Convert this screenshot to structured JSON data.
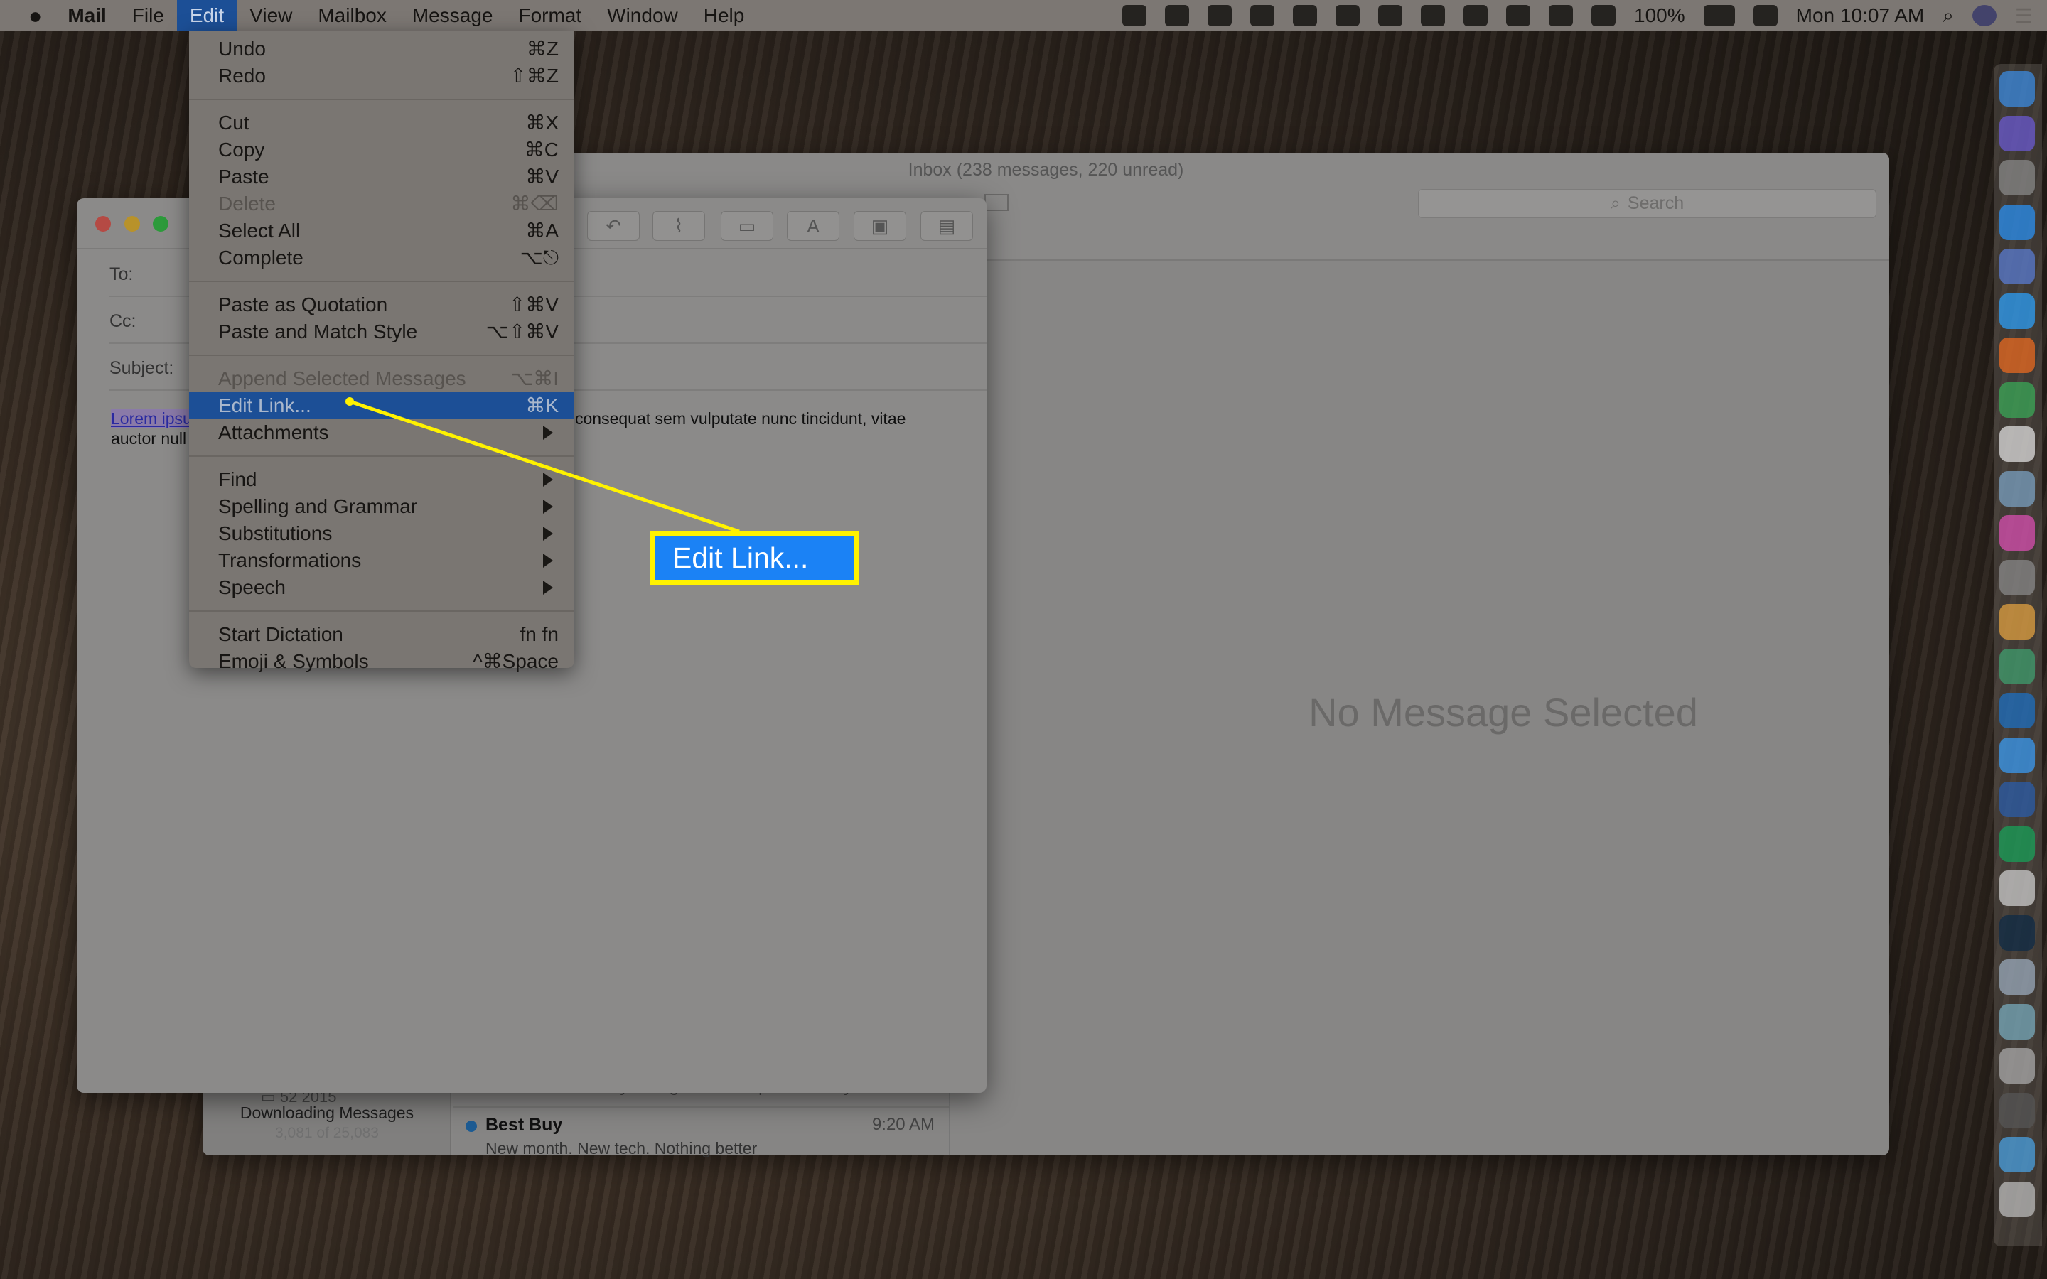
{
  "menubar": {
    "apple": "",
    "app": "Mail",
    "items": [
      "File",
      "Edit",
      "View",
      "Mailbox",
      "Message",
      "Format",
      "Window",
      "Help"
    ],
    "battery": "100%",
    "clock": "Mon 10:07 AM",
    "status_icons": [
      "dropbox-icon",
      "creative-cloud-icon",
      "cloud-upload-icon",
      "alfred-icon",
      "vpn-icon",
      "notification-bell-icon",
      "microphone-icon",
      "time-machine-icon",
      "bluetooth-icon",
      "airplay-icon",
      "wifi-icon",
      "volume-icon"
    ]
  },
  "edit_menu": {
    "items": [
      {
        "label": "Undo",
        "shortcut": "⌘Z"
      },
      {
        "label": "Redo",
        "shortcut": "⇧⌘Z"
      },
      {
        "sep": true
      },
      {
        "label": "Cut",
        "shortcut": "⌘X"
      },
      {
        "label": "Copy",
        "shortcut": "⌘C"
      },
      {
        "label": "Paste",
        "shortcut": "⌘V"
      },
      {
        "label": "Delete",
        "shortcut": "⌘⌫",
        "disabled": true
      },
      {
        "label": "Select All",
        "shortcut": "⌘A"
      },
      {
        "label": "Complete",
        "shortcut": "⌥⎋"
      },
      {
        "sep": true
      },
      {
        "label": "Paste as Quotation",
        "shortcut": "⇧⌘V"
      },
      {
        "label": "Paste and Match Style",
        "shortcut": "⌥⇧⌘V"
      },
      {
        "sep": true
      },
      {
        "label": "Append Selected Messages",
        "shortcut": "⌥⌘I",
        "disabled": true
      },
      {
        "label": "Edit Link...",
        "shortcut": "⌘K",
        "highlighted": true
      },
      {
        "label": "Attachments",
        "submenu": true
      },
      {
        "sep": true
      },
      {
        "label": "Find",
        "submenu": true
      },
      {
        "label": "Spelling and Grammar",
        "submenu": true
      },
      {
        "label": "Substitutions",
        "submenu": true
      },
      {
        "label": "Transformations",
        "submenu": true
      },
      {
        "label": "Speech",
        "submenu": true
      },
      {
        "sep": true
      },
      {
        "label": "Start Dictation",
        "shortcut": "fn fn"
      },
      {
        "label": "Emoji & Symbols",
        "shortcut": "^⌘Space"
      }
    ]
  },
  "callout": {
    "label": "Edit Link...",
    "border_color": "#fff200",
    "fill_color": "#1b82f5"
  },
  "inbox": {
    "title": "Inbox (238 messages, 220 unread)",
    "search_placeholder": "Search",
    "empty_state": "No Message Selected",
    "sidebar": {
      "folder": "52 2015",
      "status": "Downloading Messages",
      "progress": "3,081 of 25,083"
    },
    "messages": [
      {
        "preview": "all we are currently taking review requests for Systence..."
      },
      {
        "sender": "Best Buy",
        "time": "9:20 AM",
        "preview": "New month. New tech. Nothing better",
        "unread": true
      }
    ]
  },
  "compose": {
    "to_label": "To:",
    "cc_label": "Cc:",
    "subject_label": "Subject:",
    "link_text": "Lorem ipsu",
    "body_line1": "consequat sem vulputate nunc tincidunt, vitae",
    "body_line2": "auctor null",
    "toolbar": [
      "reply-icon",
      "attachment-icon",
      "markup-icon",
      "format-font-icon",
      "photo-browser-icon",
      "stationery-icon"
    ]
  },
  "dock": [
    {
      "name": "finder-icon",
      "color": "#3b8be0"
    },
    {
      "name": "siri-icon",
      "color": "#6a5ad0"
    },
    {
      "name": "launchpad-icon",
      "color": "#888"
    },
    {
      "name": "app-store-icon",
      "color": "#2a8ff0"
    },
    {
      "name": "1password-icon",
      "color": "#5a7bd0"
    },
    {
      "name": "safari-icon",
      "color": "#2c9df5"
    },
    {
      "name": "firefox-icon",
      "color": "#e86a20"
    },
    {
      "name": "chrome-icon",
      "color": "#3aa757"
    },
    {
      "name": "notes-icon",
      "color": "#ddd"
    },
    {
      "name": "preview-icon",
      "color": "#7aa0c0"
    },
    {
      "name": "itunes-icon",
      "color": "#d84fb0"
    },
    {
      "name": "system-preferences-icon",
      "color": "#888"
    },
    {
      "name": "photos-icon",
      "color": "#e0a040"
    },
    {
      "name": "slack-icon",
      "color": "#3f9e6e"
    },
    {
      "name": "trello-icon",
      "color": "#1e6fc0"
    },
    {
      "name": "messages-icon",
      "color": "#3a9af0"
    },
    {
      "name": "word-icon",
      "color": "#2b5ca8"
    },
    {
      "name": "grammarly-icon",
      "color": "#18a058"
    },
    {
      "name": "textedit-icon",
      "color": "#ccc"
    },
    {
      "name": "photoshop-icon",
      "color": "#0f2b46"
    },
    {
      "name": "image-capture-icon",
      "color": "#9ab"
    },
    {
      "name": "mail-icon",
      "color": "#7ab"
    },
    {
      "name": "downloads-stack-icon",
      "color": "#aaa"
    },
    {
      "name": "documents-stack-icon",
      "color": "#555"
    },
    {
      "name": "folder-icon",
      "color": "#4aa0e0"
    },
    {
      "name": "trash-icon",
      "color": "#bbb"
    }
  ]
}
